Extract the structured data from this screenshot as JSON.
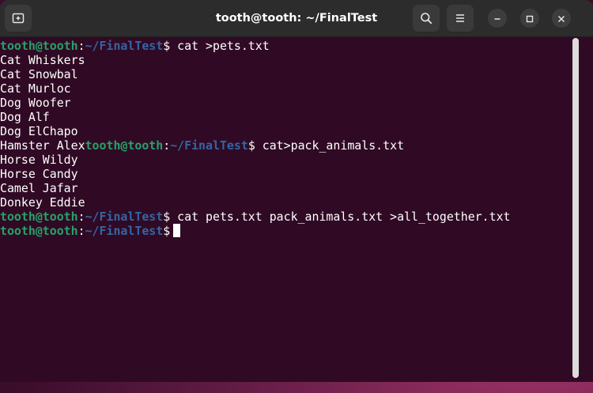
{
  "window": {
    "title": "tooth@tooth: ~/FinalTest"
  },
  "titlebar_icons": {
    "new_tab": "new-tab-icon",
    "search": "search-icon",
    "menu": "hamburger-menu-icon",
    "minimize": "minimize-icon",
    "maximize": "maximize-icon",
    "close": "close-icon"
  },
  "prompt": {
    "user_host": "tooth@tooth",
    "colon": ":",
    "path": "~/FinalTest",
    "symbol": "$"
  },
  "terminal": {
    "line1_cmd": " cat >pets.txt",
    "pets": [
      "Cat Whiskers",
      "Cat Snowbal",
      "Cat Murloc",
      "Dog Woofer",
      "Dog Alf",
      "Dog ElChapo"
    ],
    "line8_text": "Hamster Alex",
    "line8_cmd": " cat>pack_animals.txt",
    "pack": [
      "Horse Wildy",
      "Horse Candy",
      "Camel Jafar",
      "Donkey Eddie"
    ],
    "line13_cmd": " cat pets.txt pack_animals.txt >all_together.txt"
  },
  "colors": {
    "terminal_bg": "#300a24",
    "user_host": "#26a269",
    "path": "#3465a4",
    "titlebar_bg": "#2c2c2c"
  }
}
